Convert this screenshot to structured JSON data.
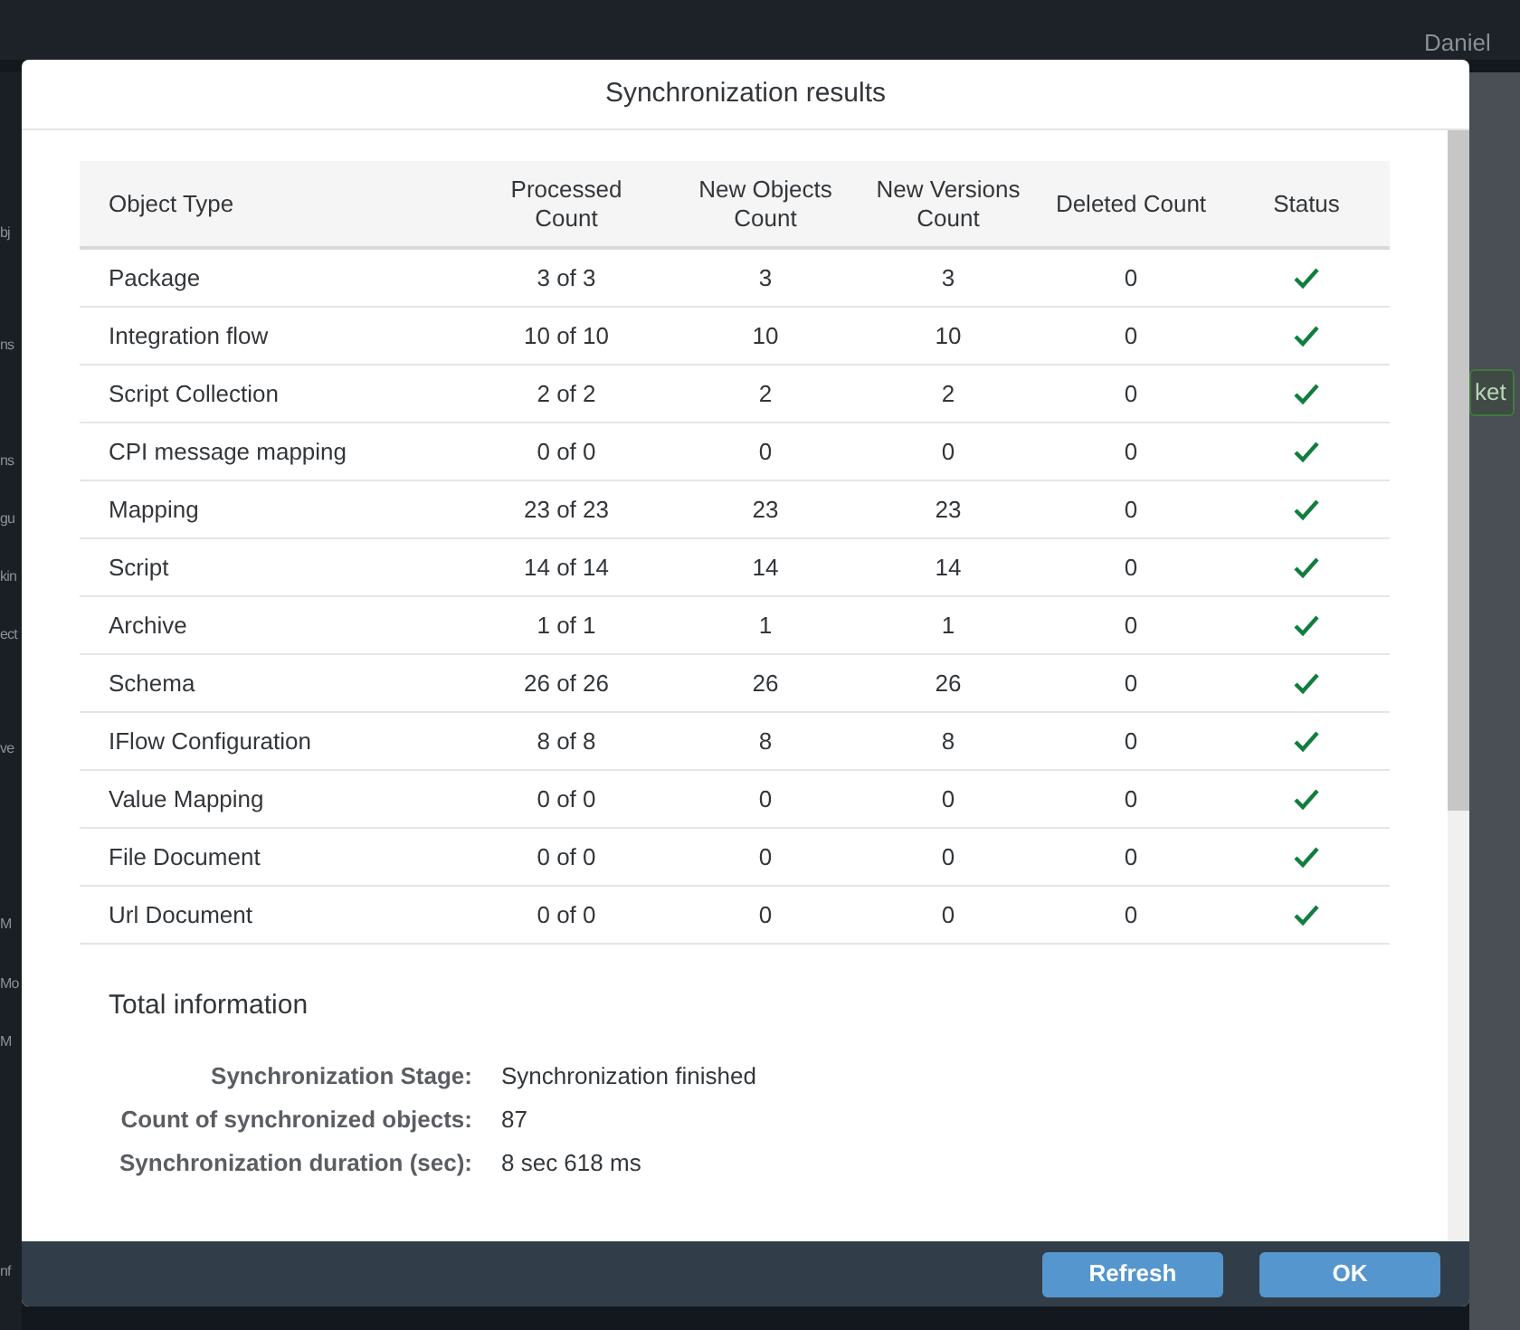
{
  "background": {
    "user_name": "Daniel",
    "sidebar_fragments": [
      "bj",
      "ns",
      "ns",
      "gu",
      "kin",
      "ect",
      "ve",
      "M",
      "Mo",
      "M",
      "nf"
    ],
    "side_button": "ket"
  },
  "dialog": {
    "title": "Synchronization results",
    "table": {
      "columns": [
        "Object Type",
        "Processed Count",
        "New Objects Count",
        "New Versions Count",
        "Deleted Count",
        "Status"
      ],
      "rows": [
        {
          "object_type": "Package",
          "processed": "3 of 3",
          "new_objects": "3",
          "new_versions": "3",
          "deleted": "0",
          "status_ok": true
        },
        {
          "object_type": "Integration flow",
          "processed": "10 of 10",
          "new_objects": "10",
          "new_versions": "10",
          "deleted": "0",
          "status_ok": true
        },
        {
          "object_type": "Script Collection",
          "processed": "2 of 2",
          "new_objects": "2",
          "new_versions": "2",
          "deleted": "0",
          "status_ok": true
        },
        {
          "object_type": "CPI message mapping",
          "processed": "0 of 0",
          "new_objects": "0",
          "new_versions": "0",
          "deleted": "0",
          "status_ok": true
        },
        {
          "object_type": "Mapping",
          "processed": "23 of 23",
          "new_objects": "23",
          "new_versions": "23",
          "deleted": "0",
          "status_ok": true
        },
        {
          "object_type": "Script",
          "processed": "14 of 14",
          "new_objects": "14",
          "new_versions": "14",
          "deleted": "0",
          "status_ok": true
        },
        {
          "object_type": "Archive",
          "processed": "1 of 1",
          "new_objects": "1",
          "new_versions": "1",
          "deleted": "0",
          "status_ok": true
        },
        {
          "object_type": "Schema",
          "processed": "26 of 26",
          "new_objects": "26",
          "new_versions": "26",
          "deleted": "0",
          "status_ok": true
        },
        {
          "object_type": "IFlow Configuration",
          "processed": "8 of 8",
          "new_objects": "8",
          "new_versions": "8",
          "deleted": "0",
          "status_ok": true
        },
        {
          "object_type": "Value Mapping",
          "processed": "0 of 0",
          "new_objects": "0",
          "new_versions": "0",
          "deleted": "0",
          "status_ok": true
        },
        {
          "object_type": "File Document",
          "processed": "0 of 0",
          "new_objects": "0",
          "new_versions": "0",
          "deleted": "0",
          "status_ok": true
        },
        {
          "object_type": "Url Document",
          "processed": "0 of 0",
          "new_objects": "0",
          "new_versions": "0",
          "deleted": "0",
          "status_ok": true
        }
      ]
    },
    "total_information": {
      "title": "Total information",
      "fields": [
        {
          "label": "Synchronization Stage:",
          "value": "Synchronization finished"
        },
        {
          "label": "Count of synchronized objects:",
          "value": "87"
        },
        {
          "label": "Synchronization duration (sec):",
          "value": "8 sec 618 ms"
        }
      ]
    },
    "buttons": [
      "Refresh",
      "OK"
    ]
  }
}
